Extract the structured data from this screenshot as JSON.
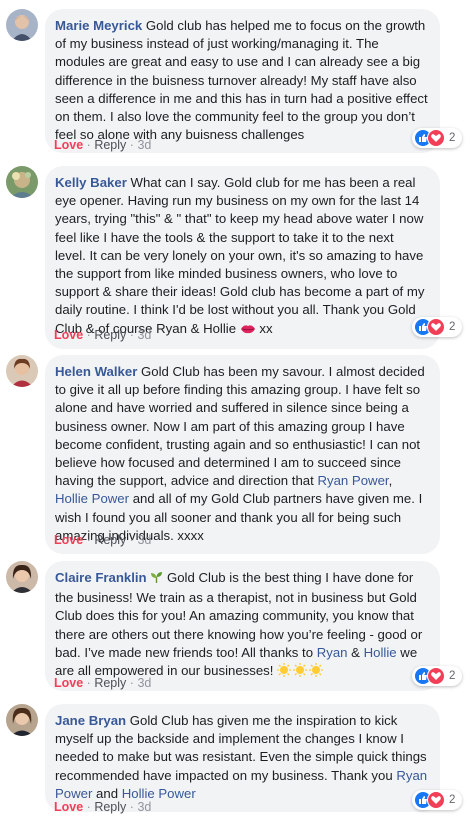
{
  "comments": [
    {
      "author": "Marie Meyrick",
      "text": "Gold club has helped me to focus on the growth of my business instead of just working/managing it. The modules are great and easy to use and I can already see a big difference in the buisness turnover already! My staff have also seen a difference in me and this has in turn had a positive effect on them. I also love the community feel to the group you don’t feel so alone with any buisness challenges",
      "love": "Love",
      "reply": "Reply",
      "sep": "·",
      "time": "3d",
      "reaction_count": "2"
    },
    {
      "author": "Kelly Baker",
      "text": "What can I say. Gold club for me has been a real eye opener. Having run my business on my own for the last 14 years, trying \"this\" & \" that\" to keep my head above water I now feel like I have the tools & the support to take it to the next level. It can be very lonely on your own, it's so amazing to have the support from like minded business owners, who love to support & share their ideas! Gold club has become a part of my daily routine. I think I'd be lost without you all. Thank you Gold Club & of course Ryan & Hollie",
      "text_end": " xx",
      "love": "Love",
      "reply": "Reply",
      "sep": "·",
      "time": "3d",
      "reaction_count": "2"
    },
    {
      "author": "Helen Walker",
      "text": "Gold Club has been my savour. I almost decided to give it all up before finding this amazing group. I have felt so alone and have worried and suffered in silence since being a business owner. Now I am part of this amazing group I have become confident, trusting again and so enthusiastic! I can not believe how focused and determined I am to succeed since having the support, advice and direction that",
      "link1": "Ryan Power",
      "mid": ", ",
      "link2": "Hollie Power",
      "text_end": " and all of my Gold Club partners have given me. I wish I found you all sooner and thank you all for being such amazing individuals. xxxx",
      "love": "Love",
      "reply": "Reply",
      "sep": "·",
      "time": "3d",
      "reaction_count": "2"
    },
    {
      "author": "Claire Franklin",
      "text": "Gold Club is the best thing I have done for the business! We train as a therapist, not in business but Gold Club does this for you! An amazing community, you know that there are others out there knowing how you’re feeling - good or bad. I’ve made new friends too! All thanks to",
      "link1": "Ryan",
      "mid": " & ",
      "link2": "Hollie",
      "text_end": " we are all empowered in our businesses!",
      "love": "Love",
      "reply": "Reply",
      "sep": "·",
      "time": "3d",
      "reaction_count": "2"
    },
    {
      "author": "Jane Bryan",
      "text": "Gold Club has given me the inspiration to kick myself up the backside and implement the changes I know I needed to make but was resistant. Even the simple quick things recommended have impacted on my business. Thank you",
      "link1": "Ryan Power",
      "mid": " and ",
      "link2": "Hollie Power",
      "love": "Love",
      "reply": "Reply",
      "sep": "·",
      "time": "3d",
      "reaction_count": "2"
    }
  ],
  "colors": {
    "author": "#385898",
    "love": "#f33e58",
    "bubble": "#f2f3f5",
    "like": "#1877f2"
  },
  "icons": [
    "like-icon",
    "love-icon",
    "lips-emoji-icon",
    "sun-emoji-icon",
    "plant-emoji-icon"
  ]
}
